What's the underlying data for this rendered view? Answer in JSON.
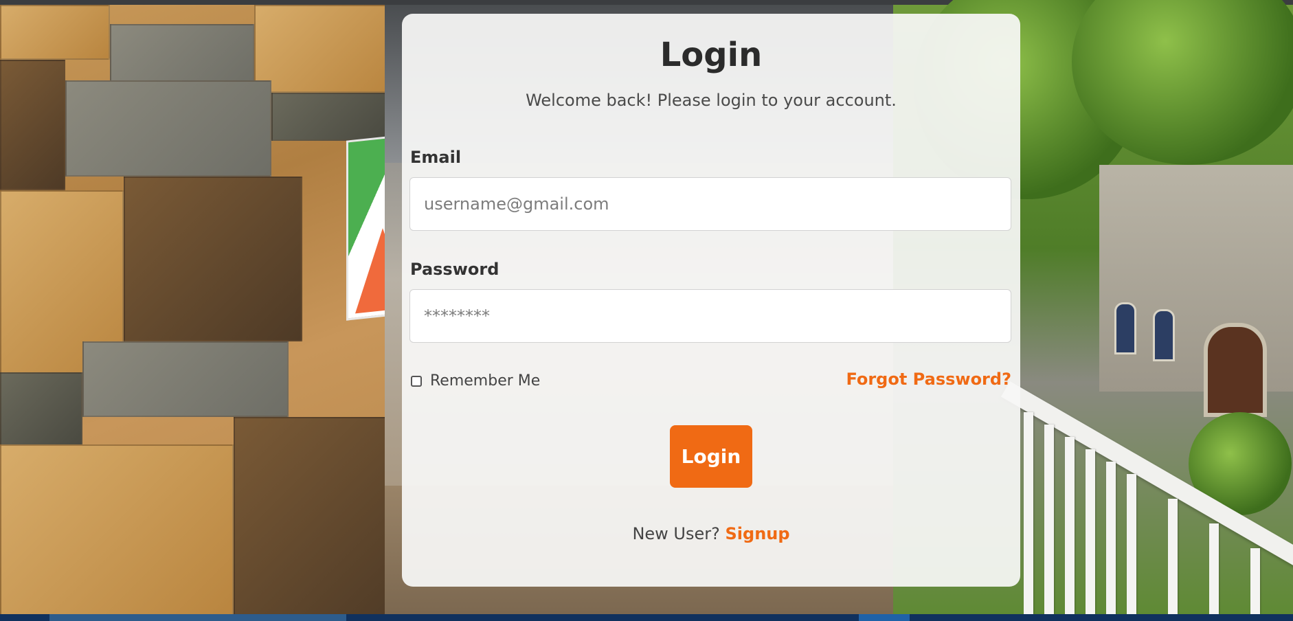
{
  "login_card": {
    "title": "Login",
    "subtitle": "Welcome back! Please login to your account.",
    "email": {
      "label": "Email",
      "placeholder": "username@gmail.com",
      "value": ""
    },
    "password": {
      "label": "Password",
      "placeholder": "********",
      "value": ""
    },
    "remember_me": {
      "label": "Remember Me",
      "checked": false
    },
    "forgot_password_label": "Forgot Password?",
    "login_button_label": "Login",
    "signup_prompt": "New User?",
    "signup_link_label": "Signup"
  },
  "colors": {
    "accent": "#f06a14",
    "card_background": "#f8f7f6",
    "title_text": "#2b2b2b"
  }
}
